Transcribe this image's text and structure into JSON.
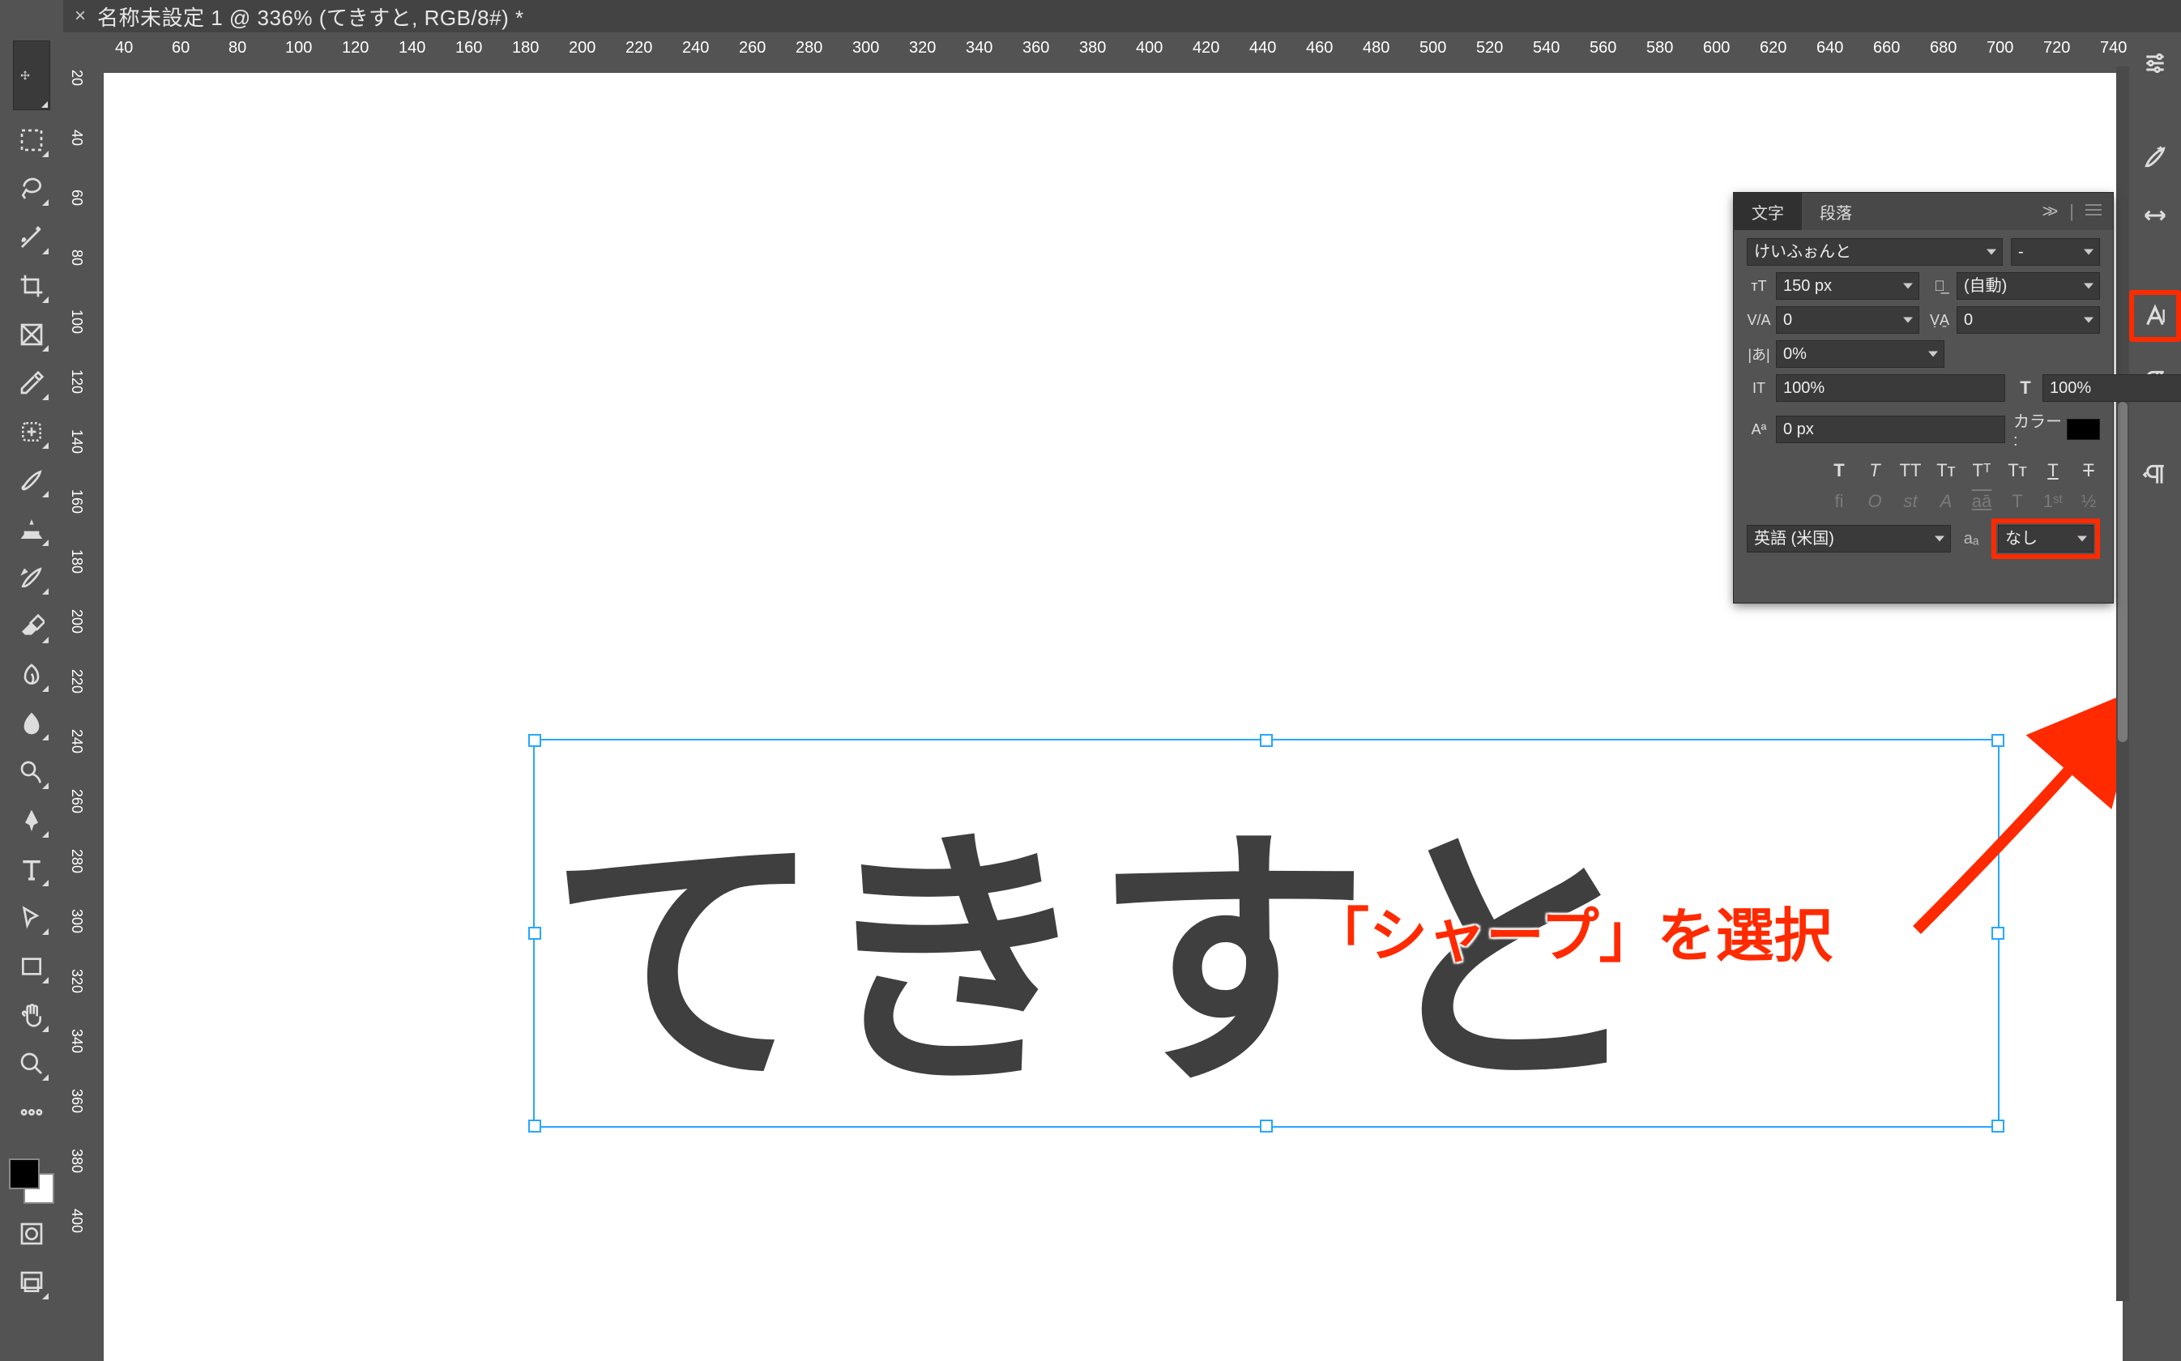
{
  "tab": {
    "close": "×",
    "title": "名称未設定 1 @ 336% (てきすと, RGB/8#) *"
  },
  "hruler": [
    "40",
    "60",
    "80",
    "100",
    "120",
    "140",
    "160",
    "180",
    "200",
    "220",
    "240",
    "260",
    "280",
    "300",
    "320",
    "340",
    "360",
    "380",
    "400",
    "420",
    "440",
    "460",
    "480",
    "500",
    "520",
    "540",
    "560",
    "580",
    "600",
    "620",
    "640",
    "660",
    "680",
    "700",
    "720",
    "740"
  ],
  "vruler": [
    "20",
    "40",
    "60",
    "80",
    "100",
    "120",
    "140",
    "160",
    "180",
    "200",
    "220",
    "240",
    "260",
    "280",
    "300",
    "320",
    "340",
    "360",
    "380",
    "400"
  ],
  "canvas": {
    "text": "てきすと"
  },
  "annotation": "「シャープ」を選択",
  "charpanel": {
    "tabs": {
      "char": "文字",
      "para": "段落"
    },
    "font_family": "けいふぉんと",
    "font_style": "-",
    "size": "150 px",
    "leading": "(自動)",
    "tracking": "0",
    "kerning": "0",
    "tsume": "0%",
    "hscale": "100%",
    "vscale": "100%",
    "baseline": "0 px",
    "color_label": "カラー :",
    "styles": {
      "bold": "T",
      "italic": "T",
      "allcaps": "TT",
      "smallcaps": "Tᴛ",
      "super": "Tᵀ",
      "sub": "Tᴛ",
      "under": "T",
      "strike": "T"
    },
    "ot": {
      "fi": "fi",
      "o": "O",
      "st": "st",
      "A": "A",
      "aa": "aā",
      "T": "T",
      "first": "1ˢᵗ",
      "half": "½"
    },
    "language": "英語 (米国)",
    "aa": "aₐ",
    "antialias": "なし"
  }
}
